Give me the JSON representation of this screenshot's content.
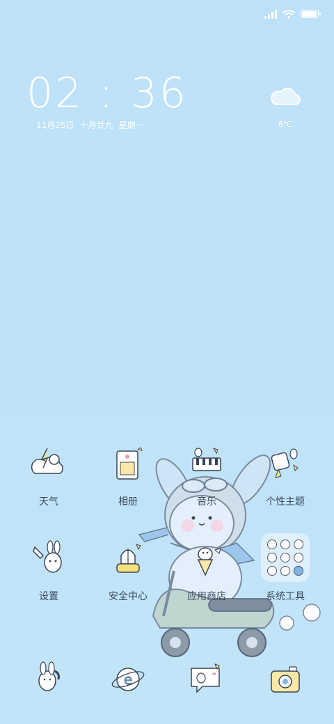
{
  "status_bar": {
    "signal_icon": "signal-icon",
    "wifi_icon": "wifi-icon",
    "battery_icon": "battery-icon",
    "battery_level": 0.95
  },
  "clock_widget": {
    "time": "02 : 36",
    "date": "11月25日",
    "lunar_date": "十月廿九",
    "weekday": "星期一"
  },
  "weather_widget": {
    "icon": "cloud-icon",
    "temperature": "8℃"
  },
  "apps": [
    {
      "label": "天气",
      "icon": "weather-app-icon"
    },
    {
      "label": "相册",
      "icon": "gallery-app-icon"
    },
    {
      "label": "音乐",
      "icon": "music-app-icon"
    },
    {
      "label": "个性主题",
      "icon": "themes-app-icon"
    },
    {
      "label": "设置",
      "icon": "settings-app-icon"
    },
    {
      "label": "安全中心",
      "icon": "security-app-icon"
    },
    {
      "label": "应用商店",
      "icon": "app-store-icon"
    },
    {
      "label": "系统工具",
      "icon": "system-tools-folder-icon"
    }
  ],
  "dock": [
    {
      "icon": "phone-app-icon"
    },
    {
      "icon": "browser-app-icon"
    },
    {
      "icon": "messages-app-icon"
    },
    {
      "icon": "camera-app-icon"
    }
  ]
}
